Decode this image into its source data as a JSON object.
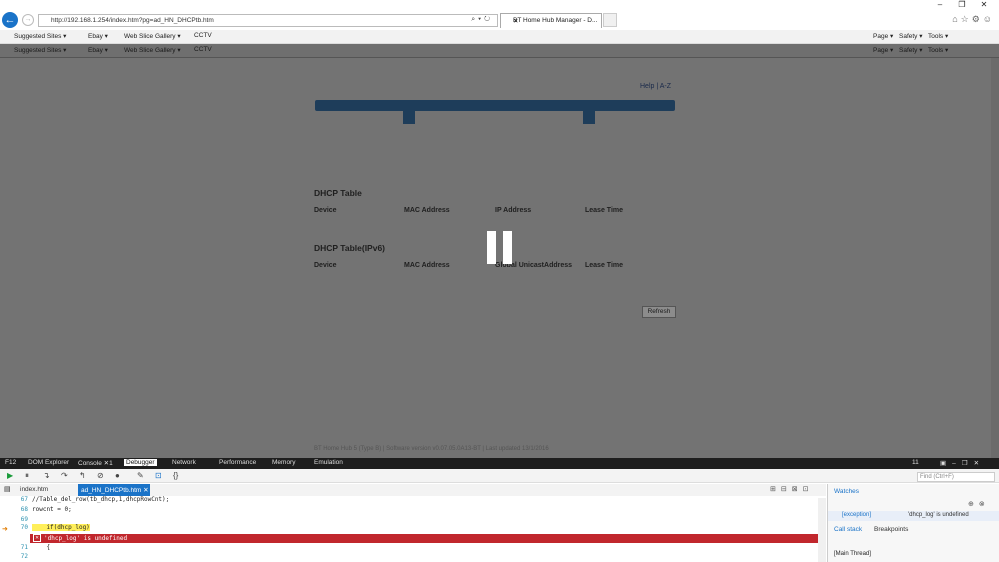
{
  "browser": {
    "url": "http://192.168.1.254/index.htm?pg=ad_HN_DHCPtb.htm",
    "tab_title": "BT Home Hub Manager - D...",
    "favorites": [
      "Suggested Sites ▾",
      "Ebay ▾",
      "Web Slice Gallery ▾",
      "CCTV"
    ],
    "commands": [
      "Page ▾",
      "Safety ▾",
      "Tools ▾"
    ]
  },
  "page": {
    "help": "Help | A-Z",
    "dhcp_title": "DHCP Table",
    "dhcp_cols": [
      "Device",
      "MAC Address",
      "IP Address",
      "Lease Time"
    ],
    "dhcp6_title": "DHCP Table(IPv6)",
    "dhcp6_cols": [
      "Device",
      "MAC Address",
      "Global UnicastAddress",
      "Lease Time"
    ],
    "refresh": "Refresh",
    "footer": "BT Home Hub 5 (Type B) | Software version v0.07.05.0A13-BT | Last updated 13/1/2016"
  },
  "devtools": {
    "f12": "F12",
    "tabs": [
      "DOM Explorer",
      "Console ✕1",
      "Debugger",
      "Network",
      "Performance",
      "Memory",
      "Emulation"
    ],
    "active_tab": "Debugger",
    "error_count": "11",
    "find_placeholder": "Find (Ctrl+F)",
    "files": [
      "index.htm",
      "ad_HN_DHCPtb.htm"
    ],
    "code": [
      {
        "n": "67",
        "src": "//Table_del_row(tb_dhcp,1,dhcpRowCnt);"
      },
      {
        "n": "68",
        "src": "rowcnt = 0;"
      },
      {
        "n": "69",
        "src": ""
      },
      {
        "n": "70",
        "src": "    if(dhcp_log)"
      },
      {
        "n": "",
        "src": ""
      },
      {
        "n": "71",
        "src": "    {"
      },
      {
        "n": "72",
        "src": ""
      }
    ],
    "error_msg": "'dhcp_log' is undefined",
    "watches": "Watches",
    "watch_name": "[exception]",
    "watch_value": "'dhcp_log' is undefined",
    "call_stack": "Call stack",
    "breakpoints": "Breakpoints",
    "main_thread": "[Main Thread]"
  },
  "colors": {
    "nav": "#1e3d5a",
    "page_bg": "#737373",
    "error": "#c1272d",
    "accent": "#1a73c8"
  }
}
